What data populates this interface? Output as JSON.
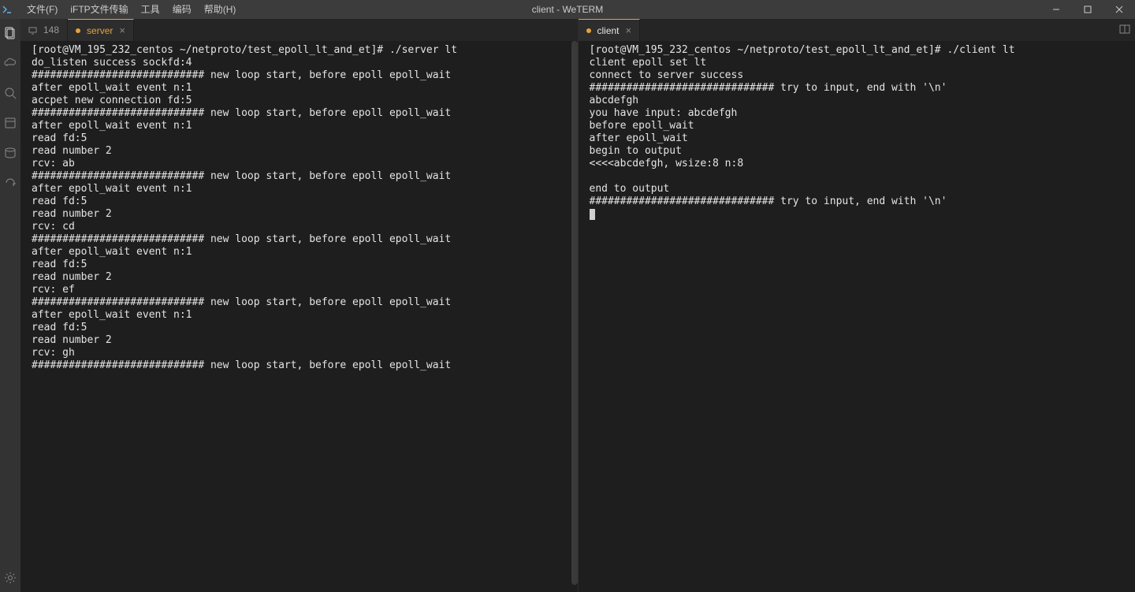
{
  "title": "client - WeTERM",
  "menu": {
    "file": "文件(F)",
    "transfer": "iFTP文件传输",
    "tools": "工具",
    "encoding": "编码",
    "help": "帮助(H)"
  },
  "tabs": {
    "left_inactive": "148",
    "left_active": "server",
    "right_active": "client"
  },
  "terminal_left": "[root@VM_195_232_centos ~/netproto/test_epoll_lt_and_et]# ./server lt\ndo_listen success sockfd:4\n############################ new loop start, before epoll epoll_wait\nafter epoll_wait event n:1\naccpet new connection fd:5\n############################ new loop start, before epoll epoll_wait\nafter epoll_wait event n:1\nread fd:5\nread number 2\nrcv: ab\n############################ new loop start, before epoll epoll_wait\nafter epoll_wait event n:1\nread fd:5\nread number 2\nrcv: cd\n############################ new loop start, before epoll epoll_wait\nafter epoll_wait event n:1\nread fd:5\nread number 2\nrcv: ef\n############################ new loop start, before epoll epoll_wait\nafter epoll_wait event n:1\nread fd:5\nread number 2\nrcv: gh\n############################ new loop start, before epoll epoll_wait",
  "terminal_right": "[root@VM_195_232_centos ~/netproto/test_epoll_lt_and_et]# ./client lt\nclient epoll set lt\nconnect to server success\n############################## try to input, end with '\\n'\nabcdefgh\nyou have input: abcdefgh\nbefore epoll_wait\nafter epoll_wait\nbegin to output\n<<<<abcdefgh, wsize:8 n:8\n\nend to output\n############################## try to input, end with '\\n'"
}
